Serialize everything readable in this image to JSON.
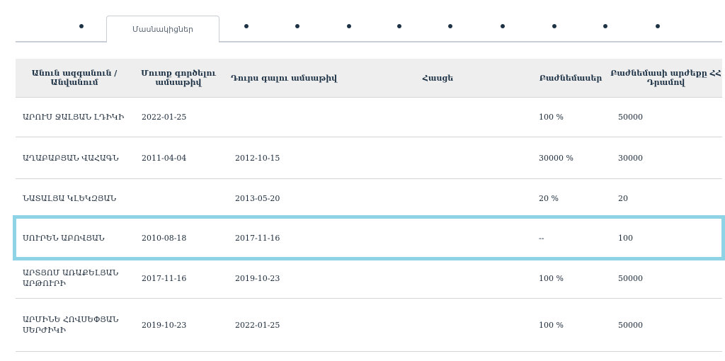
{
  "tabs": {
    "active_label": "Մասնակիցներ"
  },
  "table": {
    "headers": {
      "name": "Անուն ազգանուն / Անվանում",
      "entry_date": "Մուտք գործելու ամսաթիվ",
      "exit_date": "Դուրս գալու ամսաթիվ",
      "address": "Հասցե",
      "shares": "Բաժնեմասեր",
      "share_value": "Բաժնեմասի արժեքը ՀՀ Դրամով"
    },
    "rows": [
      {
        "name": "ԱՐՈՒՍ ՋԱԼՅԱՆ ԼԴԻԿԻ",
        "entry_date": "2022-01-25",
        "exit_date": "",
        "address": "",
        "shares": "100 %",
        "share_value": "50000"
      },
      {
        "name": "ԱՂԱԲԱԲՅԱՆ ՎԱՀԱԳՆ",
        "entry_date": "2011-04-04",
        "exit_date": "2012-10-15",
        "address": "",
        "shares": "30000 %",
        "share_value": "30000"
      },
      {
        "name": "ՆԱՏԱԼՅԱ ԿԼԵԿԶՅԱՆ",
        "entry_date": "",
        "exit_date": "2013-05-20",
        "address": "",
        "shares": "20 %",
        "share_value": "20"
      },
      {
        "name": "ՍՈՒՐԵՆ ԱԲՈՎՅԱՆ",
        "entry_date": "2010-08-18",
        "exit_date": "2017-11-16",
        "address": "",
        "shares": "--",
        "share_value": "100"
      },
      {
        "name": "ԱՐՏՅՈՄ ԱՌԱՔԵԼՅԱՆ ԱՐԹՈՒՐԻ",
        "entry_date": "2017-11-16",
        "exit_date": "2019-10-23",
        "address": "",
        "shares": "100 %",
        "share_value": "50000"
      },
      {
        "name": "ԱՐՄԻՆԵ ՀՈՎՍԵՓՅԱՆ ՍԵՐԺԻԿԻ",
        "entry_date": "2019-10-23",
        "exit_date": "2022-01-25",
        "address": "",
        "shares": "100 %",
        "share_value": "50000"
      }
    ]
  },
  "colors": {
    "highlight": "#8fd3e6",
    "header_bg": "#eeeeee",
    "text": "#1b2a3a"
  }
}
